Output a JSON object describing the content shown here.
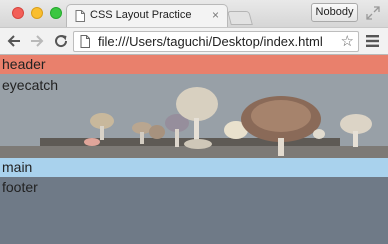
{
  "window": {
    "tab_title": "CSS Layout Practice",
    "tab_close": "×",
    "profile_label": "Nobody"
  },
  "toolbar": {
    "url": "file:///Users/taguchi/Desktop/index.html",
    "star": "☆"
  },
  "page": {
    "header": "header",
    "eyecatch": "eyecatch",
    "main": "main",
    "footer": "footer"
  },
  "colors": {
    "header_bg": "#e9806c",
    "main_bg": "#a9d2ed",
    "footer_bg": "#6f7a87"
  }
}
